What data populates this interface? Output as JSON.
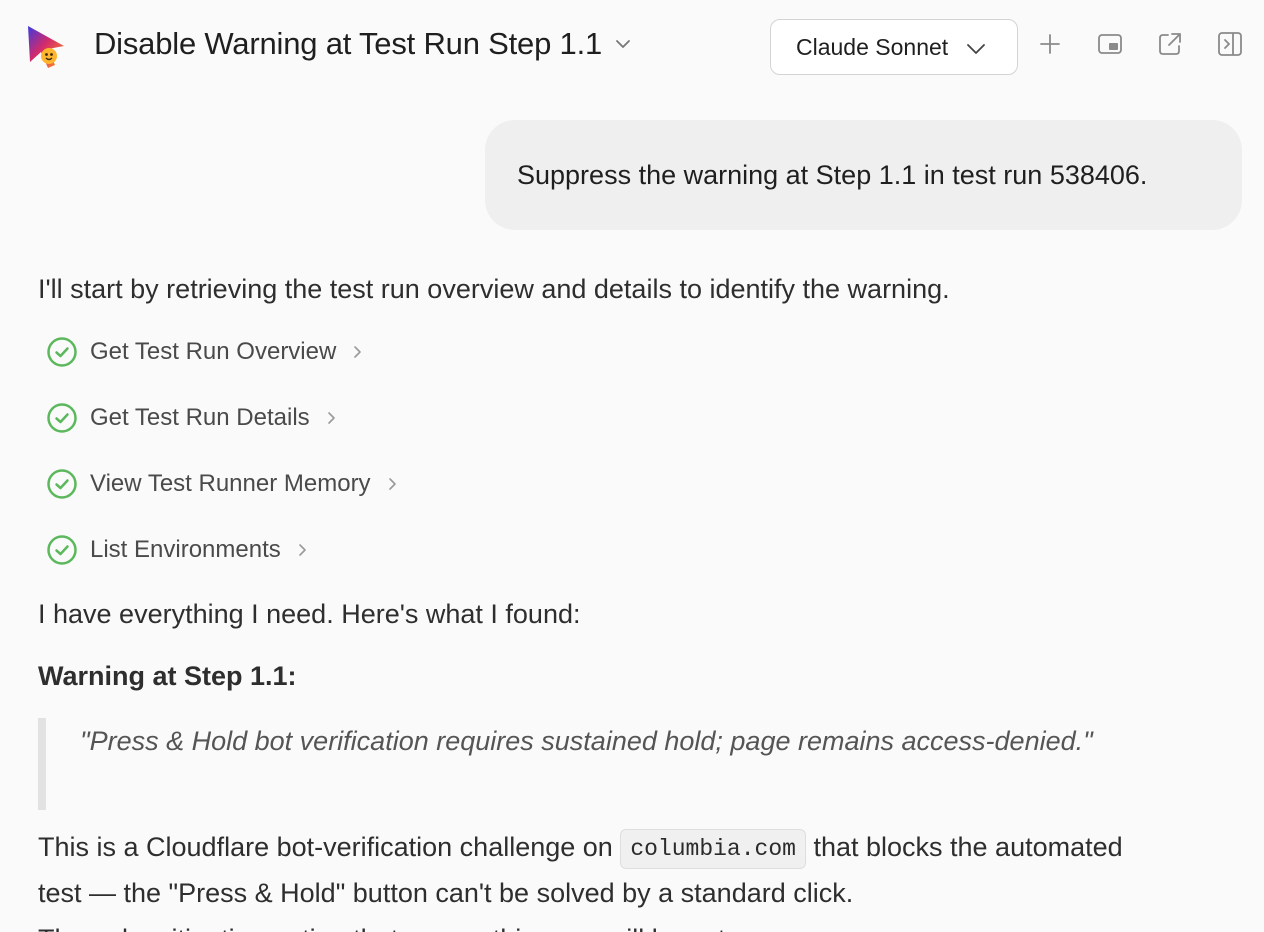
{
  "header": {
    "title": "Disable Warning at Test Run Step 1.1",
    "model_selector": "Claude Sonnet"
  },
  "conversation": {
    "user_message": "Suppress the warning at Step 1.1 in test run 538406.",
    "assistant": {
      "intro": "I'll start by retrieving the test run overview and details to identify the warning.",
      "tool_steps": [
        {
          "label": "Get Test Run Overview",
          "status": "completed"
        },
        {
          "label": "Get Test Run Details",
          "status": "completed"
        },
        {
          "label": "View Test Runner Memory",
          "status": "completed"
        },
        {
          "label": "List Environments",
          "status": "completed"
        }
      ],
      "found_text": "I have everything I need. Here's what I found:",
      "warning_heading": "Warning at Step 1.1:",
      "warning_quote": "\"Press & Hold bot verification requires sustained hold; page remains access-denied.\"",
      "explanation_before_code": "This is a Cloudflare bot-verification challenge on ",
      "explanation_code": "columbia.com",
      "explanation_after_code": " that blocks the automated test — the \"Press & Hold\" button can't be solved by a standard click.",
      "explanation_cut_line": "The only mitigation option that covers this case will be set..."
    }
  },
  "colors": {
    "background": "#fafafa",
    "bubble": "#efefef",
    "check_green": "#5cb85c",
    "quote_border": "#e2e2e2"
  },
  "icons": [
    "app-logo-icon",
    "chevron-down-icon",
    "plus-icon",
    "picture-in-picture-icon",
    "external-link-icon",
    "sidebar-toggle-icon",
    "check-circle-icon",
    "chevron-right-icon"
  ]
}
